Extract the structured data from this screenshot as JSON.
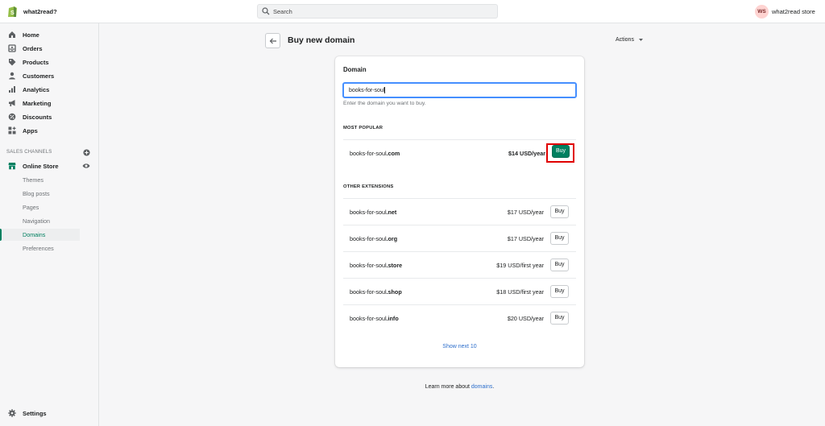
{
  "topbar": {
    "store_name": "what2read?",
    "search_placeholder": "Search",
    "avatar_initials": "WS",
    "account_name": "what2read store"
  },
  "sidebar": {
    "items": [
      {
        "label": "Home",
        "icon": "home-icon"
      },
      {
        "label": "Orders",
        "icon": "orders-icon"
      },
      {
        "label": "Products",
        "icon": "tag-icon"
      },
      {
        "label": "Customers",
        "icon": "person-icon"
      },
      {
        "label": "Analytics",
        "icon": "bar-chart-icon"
      },
      {
        "label": "Marketing",
        "icon": "megaphone-icon"
      },
      {
        "label": "Discounts",
        "icon": "discount-icon"
      },
      {
        "label": "Apps",
        "icon": "apps-icon"
      }
    ],
    "sales_channels_heading": "SALES CHANNELS",
    "online_store_label": "Online Store",
    "sub_items": [
      {
        "label": "Themes"
      },
      {
        "label": "Blog posts"
      },
      {
        "label": "Pages"
      },
      {
        "label": "Navigation"
      },
      {
        "label": "Domains"
      },
      {
        "label": "Preferences"
      }
    ],
    "settings_label": "Settings"
  },
  "page": {
    "title": "Buy new domain",
    "actions_label": "Actions"
  },
  "card": {
    "title": "Domain",
    "input_value": "books-for-soul",
    "help_text": "Enter the domain you want to buy.",
    "most_popular_heading": "MOST POPULAR",
    "popular": {
      "base": "books-for-soul",
      "ext": ".com",
      "price": "$14 USD/year",
      "buy_label": "Buy"
    },
    "other_heading": "OTHER EXTENSIONS",
    "others": [
      {
        "base": "books-for-soul",
        "ext": ".net",
        "price": "$17 USD/year",
        "buy_label": "Buy"
      },
      {
        "base": "books-for-soul",
        "ext": ".org",
        "price": "$17 USD/year",
        "buy_label": "Buy"
      },
      {
        "base": "books-for-soul",
        "ext": ".store",
        "price": "$19 USD/first year",
        "buy_label": "Buy"
      },
      {
        "base": "books-for-soul",
        "ext": ".shop",
        "price": "$18 USD/first year",
        "buy_label": "Buy"
      },
      {
        "base": "books-for-soul",
        "ext": ".info",
        "price": "$20 USD/year",
        "buy_label": "Buy"
      }
    ],
    "show_next_label": "Show next 10"
  },
  "footer": {
    "learn_prefix": "Learn more about ",
    "learn_link": "domains",
    "learn_suffix": "."
  },
  "colors": {
    "accent": "#008060",
    "link": "#2c6ecb",
    "highlight": "#e00000",
    "focus": "#458fff"
  }
}
